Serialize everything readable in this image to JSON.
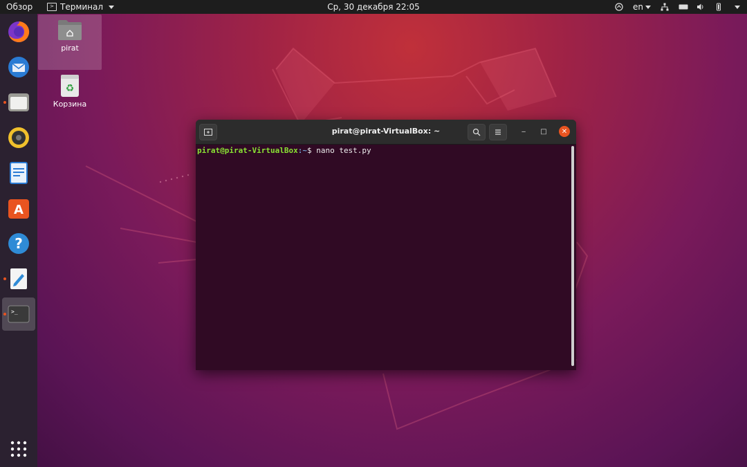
{
  "topbar": {
    "overview": "Обзор",
    "app_menu": "Терминал",
    "clock": "Ср, 30 декабря  22:05",
    "lang": "en"
  },
  "dock": {
    "items": [
      {
        "name": "firefox",
        "active": false,
        "running": false
      },
      {
        "name": "thunderbird",
        "active": false,
        "running": false
      },
      {
        "name": "files",
        "active": false,
        "running": true
      },
      {
        "name": "rhythmbox",
        "active": false,
        "running": false
      },
      {
        "name": "libreoffice-writer",
        "active": false,
        "running": false
      },
      {
        "name": "software-center",
        "active": false,
        "running": false
      },
      {
        "name": "help",
        "active": false,
        "running": false
      },
      {
        "name": "text-editor",
        "active": false,
        "running": true
      },
      {
        "name": "terminal",
        "active": true,
        "running": true
      }
    ],
    "show_apps_icon": "grid-icon"
  },
  "desktop": {
    "icons": [
      {
        "label": "pirat",
        "icon": "home-folder-icon"
      },
      {
        "label": "Корзина",
        "icon": "trash-icon"
      }
    ]
  },
  "terminal": {
    "title": "pirat@pirat-VirtualBox: ~",
    "prompt_user": "pirat@pirat-VirtualBox",
    "prompt_path": ":~",
    "prompt_symbol": "$ ",
    "command": "nano test.py",
    "minimize": "‒",
    "maximize": "□",
    "close": "✕"
  }
}
